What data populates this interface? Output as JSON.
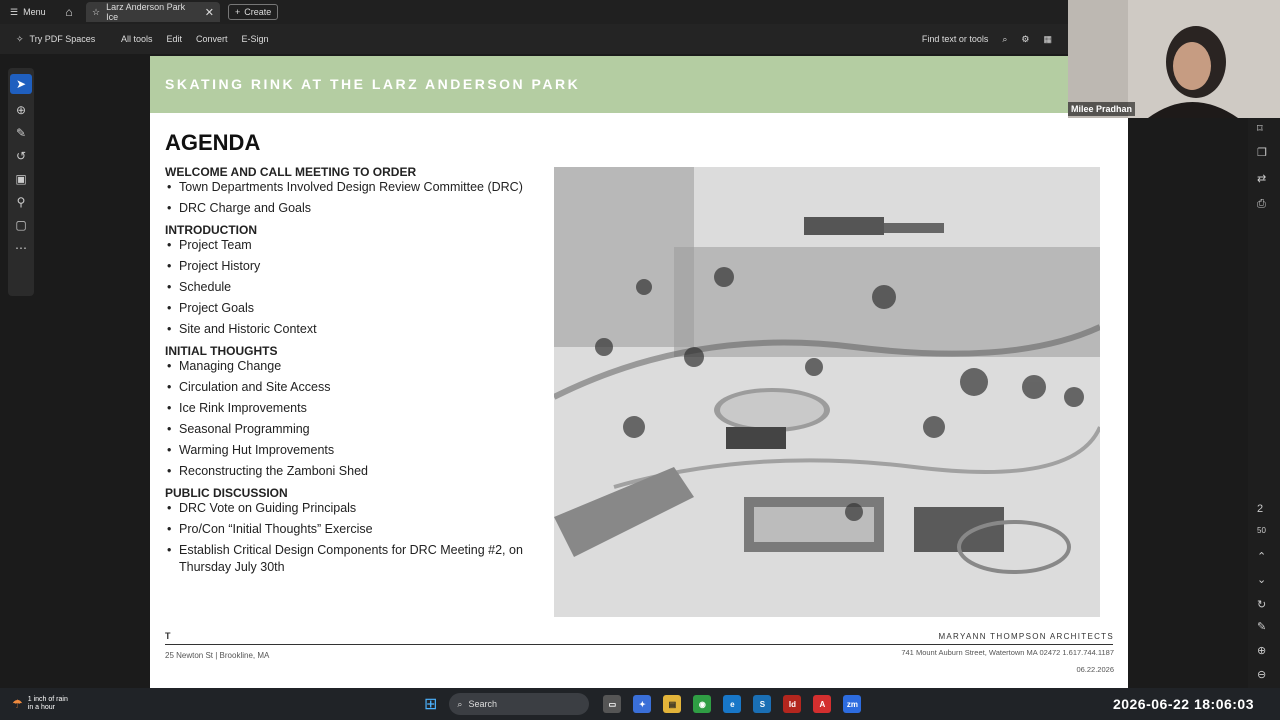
{
  "titlebar": {
    "menu_label": "Menu",
    "tab_label": "Larz Anderson Park Ice",
    "create_label": "Create"
  },
  "toolbar": {
    "pdf_spaces": "Try PDF Spaces",
    "tools": [
      "All tools",
      "Edit",
      "Convert",
      "E-Sign"
    ],
    "find_label": "Find text or tools"
  },
  "slide": {
    "banner_title": "SKATING RINK AT THE LARZ ANDERSON PARK",
    "banner_color": "#b4cda2",
    "heading": "AGENDA",
    "sections": [
      {
        "title": "WELCOME AND CALL MEETING TO ORDER",
        "items": [
          "Town Departments Involved Design Review Committee (DRC)",
          "DRC Charge and Goals"
        ]
      },
      {
        "title": "INTRODUCTION",
        "items": [
          "Project Team",
          "Project History",
          "Schedule",
          "Project Goals",
          "Site and Historic Context"
        ]
      },
      {
        "title": "INITIAL THOUGHTS",
        "items": [
          "Managing Change",
          "Circulation and Site Access",
          "Ice Rink Improvements",
          "Seasonal Programming",
          "Warming Hut Improvements",
          "Reconstructing the Zamboni Shed"
        ]
      },
      {
        "title": "PUBLIC DISCUSSION",
        "items": [
          "DRC Vote on Guiding Principals",
          "Pro/Con “Initial Thoughts” Exercise",
          "Establish Critical Design Components for DRC Meeting #2, on Thursday July 30th"
        ]
      }
    ],
    "footer": {
      "mark": "T",
      "address_left": "25 Newton St | Brookline, MA",
      "firm": "MARYANN THOMPSON ARCHITECTS",
      "address_right": "741 Mount Auburn Street, Watertown MA 02472   1.617.744.1187",
      "date": "06.22.2026"
    }
  },
  "video": {
    "participant_name": "Milee Pradhan"
  },
  "rightrail": {
    "page_number": "2",
    "page_total": "50"
  },
  "taskbar": {
    "weather_line1": "1 inch of rain",
    "weather_line2": "in a hour",
    "search_placeholder": "Search",
    "datetime": "2026-06-22  18:06:03"
  }
}
